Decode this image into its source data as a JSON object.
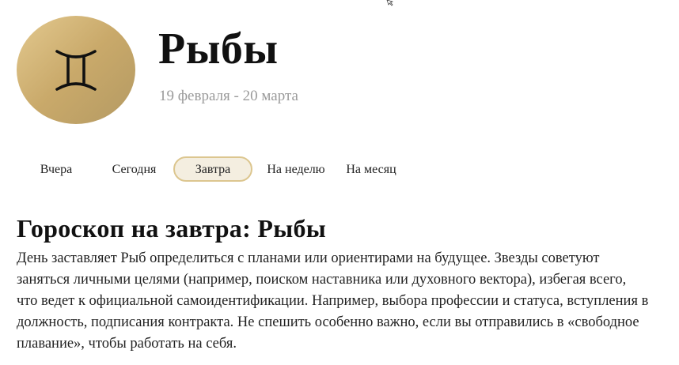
{
  "sign": {
    "name": "Рыбы",
    "dates": "19 февраля - 20 марта",
    "icon": "zodiac-glyph-icon",
    "circle_gradient": [
      "#e3c98f",
      "#b49a63"
    ]
  },
  "tabs": [
    {
      "label": "Вчера",
      "active": false
    },
    {
      "label": "Сегодня",
      "active": false
    },
    {
      "label": "Завтра",
      "active": true
    },
    {
      "label": "На неделю",
      "active": false
    },
    {
      "label": "На месяц",
      "active": false
    }
  ],
  "horoscope": {
    "title": "Гороскоп на завтра: Рыбы",
    "text": "День заставляет Рыб определиться с планами или ориентирами на будущее. Звезды советуют заняться личными целями (например, поиском наставника или духовного вектора), избегая всего, что ведет к официальной самоидентификации. Например, выбора профессии и статуса, вступления в должность, подписания контракта. Не спешить особенно важно, если вы отправились в «свободное плавание», чтобы работать на себя."
  },
  "colors": {
    "active_tab_bg": "#f4eee0",
    "active_tab_border": "#dcc68f",
    "dates_text": "#9a9a9a"
  }
}
